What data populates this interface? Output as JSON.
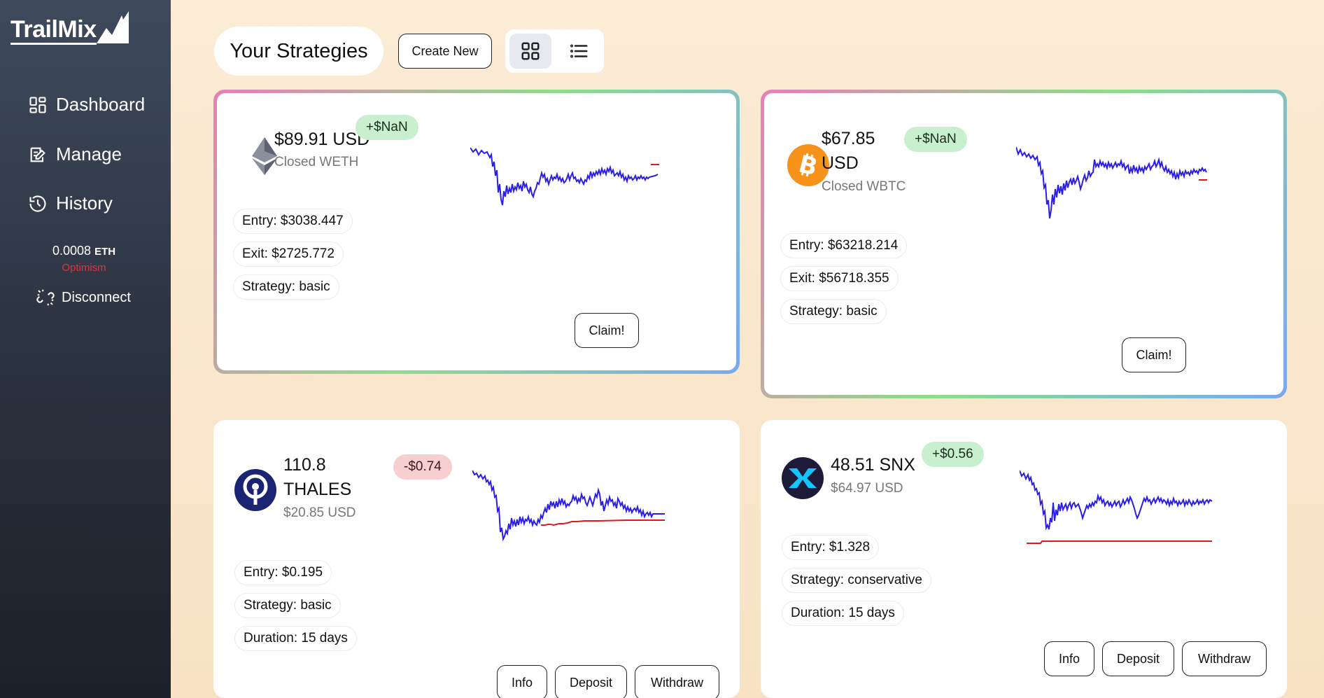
{
  "app": {
    "logo": "TrailMix"
  },
  "sidebar": {
    "items": [
      {
        "label": "Dashboard",
        "icon": "dashboard-icon"
      },
      {
        "label": "Manage",
        "icon": "manage-icon"
      },
      {
        "label": "History",
        "icon": "history-icon"
      }
    ],
    "balance_value": "0.0008",
    "balance_unit": "ETH",
    "network": "Optimism",
    "disconnect_label": "Disconnect"
  },
  "header": {
    "title": "Your Strategies",
    "create_label": "Create New",
    "view_grid_icon": "grid-view-icon",
    "view_list_icon": "list-view-icon"
  },
  "colors": {
    "price_line": "#2a1ee8",
    "stop_line": "#e0191f",
    "positive_badge": "#c8f0cf",
    "negative_badge": "#f7cfd1",
    "eth_icon": "#6b7180",
    "btc_icon": "#f7931a",
    "thales_icon": "#1a2472",
    "snx_icon": "#1e1a3a"
  },
  "cards": [
    {
      "amount": "$89.91 USD",
      "sub": "Closed WETH",
      "badge": "+$NaN",
      "details": [
        "Entry: $3038.447",
        "Exit: $2725.772",
        "Strategy: basic"
      ],
      "buttons": [
        "Claim!"
      ],
      "icon": "ethereum-icon"
    },
    {
      "amount_line1": "$67.85",
      "amount_line2": "USD",
      "sub": "Closed WBTC",
      "badge": "+$NaN",
      "details": [
        "Entry: $63218.214",
        "Exit: $56718.355",
        "Strategy: basic"
      ],
      "buttons": [
        "Claim!"
      ],
      "icon": "bitcoin-icon"
    },
    {
      "amount_line1": "110.8",
      "amount_line2": "THALES",
      "sub": "$20.85 USD",
      "badge": "-$0.74",
      "details": [
        "Entry: $0.195",
        "Strategy: basic",
        "Duration: 15 days"
      ],
      "buttons": [
        "Info",
        "Deposit",
        "Withdraw"
      ],
      "icon": "thales-icon"
    },
    {
      "amount": "48.51 SNX",
      "sub": "$64.97 USD",
      "badge": "+$0.56",
      "details": [
        "Entry: $1.328",
        "Strategy: conservative",
        "Duration: 15 days"
      ],
      "buttons": [
        "Info",
        "Deposit",
        "Withdraw"
      ],
      "icon": "synthetix-icon"
    }
  ]
}
